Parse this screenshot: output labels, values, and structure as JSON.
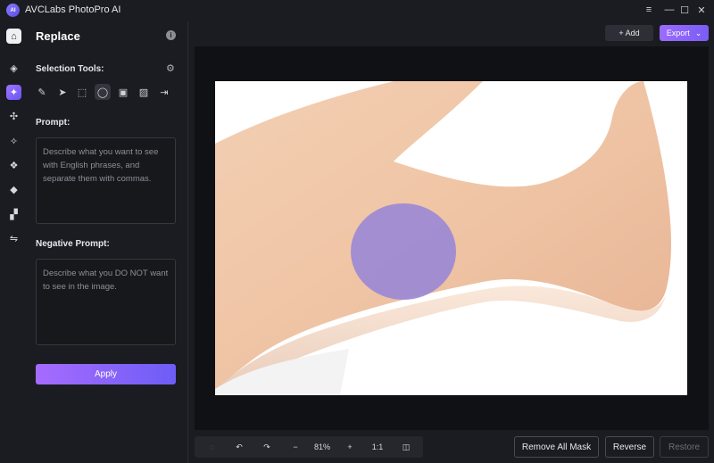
{
  "window": {
    "title": "AVCLabs PhotoPro AI",
    "logo_text": "AI",
    "controls": [
      "≡",
      "—",
      "☐",
      "✕"
    ]
  },
  "rail": {
    "items": [
      {
        "icon": "home-icon",
        "glyph": "⌂",
        "active": true,
        "home": true
      },
      {
        "icon": "eraser-icon",
        "glyph": "◈"
      },
      {
        "icon": "replace-icon",
        "glyph": "✦",
        "active": true
      },
      {
        "icon": "scatter-icon",
        "glyph": "✣"
      },
      {
        "icon": "enhance-icon",
        "glyph": "✧"
      },
      {
        "icon": "grid-icon",
        "glyph": "❖"
      },
      {
        "icon": "fill-icon",
        "glyph": "◆"
      },
      {
        "icon": "blocks-icon",
        "glyph": "▞"
      },
      {
        "icon": "adjust-icon",
        "glyph": "⇋"
      }
    ]
  },
  "panel": {
    "title": "Replace",
    "info_glyph": "i",
    "selection_tools_label": "Selection Tools:",
    "tools": [
      {
        "icon": "brush-icon",
        "glyph": "✎"
      },
      {
        "icon": "cursor-icon",
        "glyph": "➤"
      },
      {
        "icon": "rect-select-icon",
        "glyph": "⬚"
      },
      {
        "icon": "ellipse-select-icon",
        "glyph": "◯",
        "active": true
      },
      {
        "icon": "person-select-icon",
        "glyph": "▣"
      },
      {
        "icon": "object-select-icon",
        "glyph": "▨"
      },
      {
        "icon": "export-selection-icon",
        "glyph": "⇥"
      }
    ],
    "prompt_label": "Prompt:",
    "prompt_placeholder": "Describe what you want to see with English phrases, and separate them with commas.",
    "negative_label": "Negative Prompt:",
    "negative_placeholder": "Describe what you DO NOT want to see in the image.",
    "apply_label": "Apply"
  },
  "topbar": {
    "add_label": "+ Add",
    "export_label": "Export",
    "export_chevron": "⌄"
  },
  "bottombar": {
    "zoom": "81%",
    "ratio": "1:1",
    "rotate_glyph": "◌",
    "undo_glyph": "↶",
    "redo_glyph": "↷",
    "minus_glyph": "−",
    "plus_glyph": "+",
    "compare_glyph": "◫"
  },
  "actions": {
    "remove_all_mask": "Remove All Mask",
    "reverse": "Reverse",
    "restore": "Restore"
  },
  "colors": {
    "accent_start": "#a66bff",
    "accent_end": "#6d5df5",
    "mask": "#9a87d6"
  }
}
